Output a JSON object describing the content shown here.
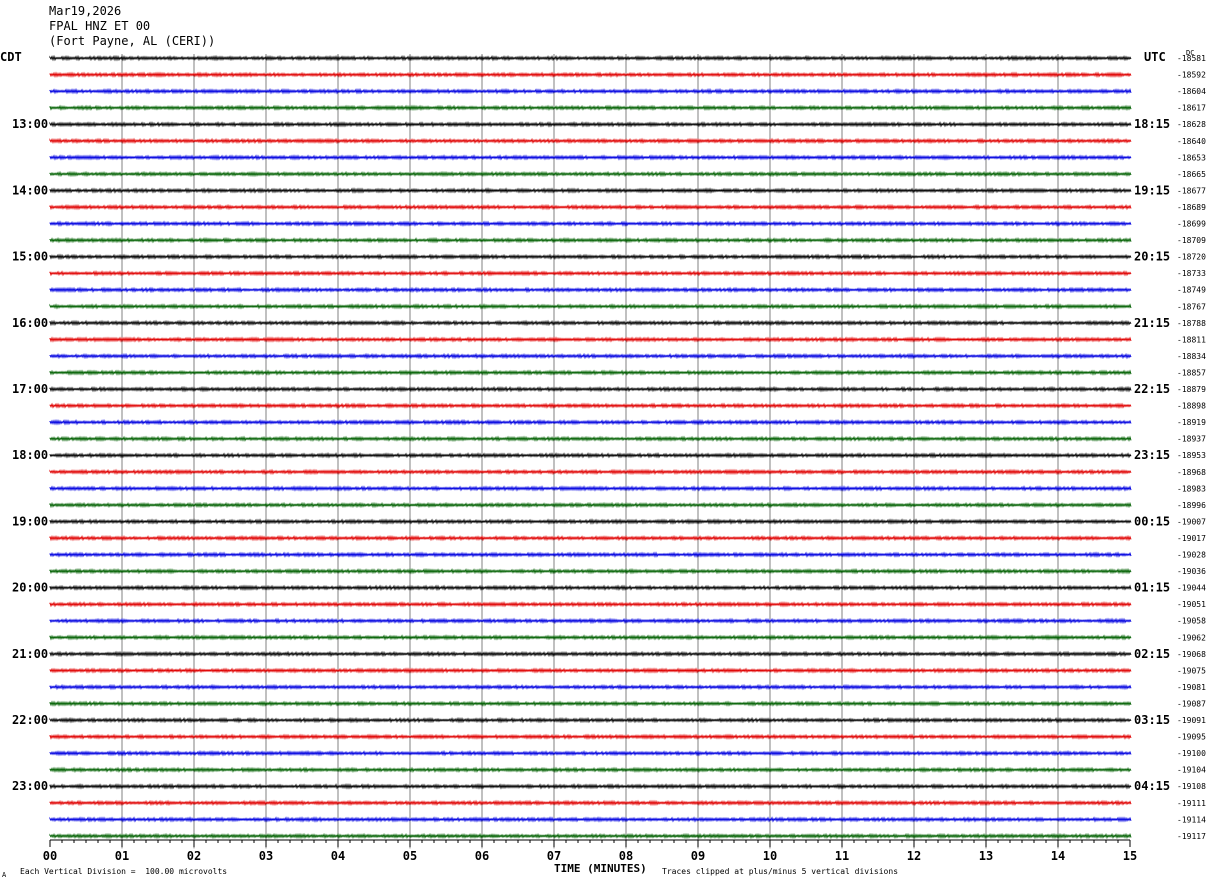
{
  "header": {
    "date": "Mar19,2026",
    "station": "FPAL HNZ ET 00",
    "location": "(Fort Payne, AL (CERI))"
  },
  "timezones": {
    "left": "CDT",
    "right": "UTC",
    "dc": "DC"
  },
  "footer": {
    "scale": "Each Vertical Division =  100.00 microvolts",
    "clip": "Traces clipped at plus/minus 5 vertical divisions",
    "corner": "A"
  },
  "colors": {
    "trace_cycle": [
      "#000000",
      "#e00000",
      "#0000e0",
      "#006000"
    ],
    "grid": "#808080"
  },
  "chart_data": {
    "type": "line",
    "title": "",
    "xlabel": "TIME (MINUTES)",
    "x_ticks": [
      "00",
      "01",
      "02",
      "03",
      "04",
      "05",
      "06",
      "07",
      "08",
      "09",
      "10",
      "11",
      "12",
      "13",
      "14",
      "15"
    ],
    "xlim": [
      0,
      15
    ],
    "rows_per_hour": 4,
    "left_hour_labels": [
      "13:00",
      "14:00",
      "15:00",
      "16:00",
      "17:00",
      "18:00",
      "19:00",
      "20:00",
      "21:00",
      "22:00",
      "23:00"
    ],
    "right_hour_labels": [
      "18:15",
      "19:15",
      "20:15",
      "21:15",
      "22:15",
      "23:15",
      "00:15",
      "01:15",
      "02:15",
      "03:15",
      "04:15"
    ],
    "trace_counts": [
      -18581,
      -18592,
      -18604,
      -18617,
      -18628,
      -18640,
      -18653,
      -18665,
      -18677,
      -18689,
      -18699,
      -18709,
      -18720,
      -18733,
      -18749,
      -18767,
      -18788,
      -18811,
      -18834,
      -18857,
      -18879,
      -18898,
      -18919,
      -18937,
      -18953,
      -18968,
      -18983,
      -18996,
      -19007,
      -19017,
      -19028,
      -19036,
      -19044,
      -19051,
      -19058,
      -19062,
      -19068,
      -19075,
      -19081,
      -19087,
      -19091,
      -19095,
      -19100,
      -19104,
      -19108,
      -19111,
      -19114,
      -19117
    ]
  }
}
